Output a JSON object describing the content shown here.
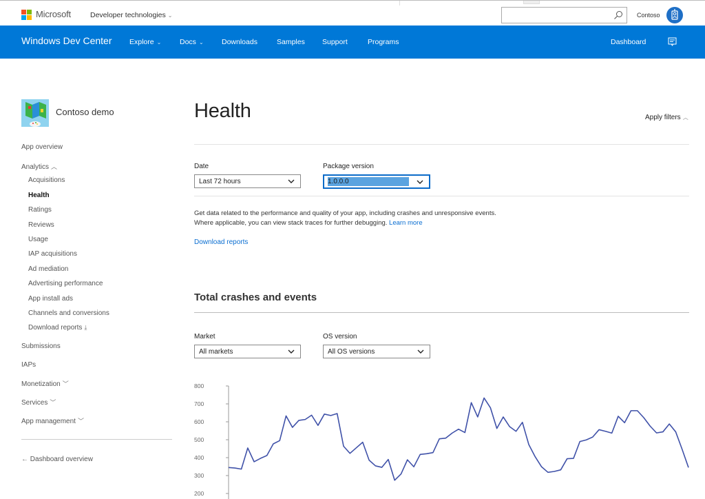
{
  "topbar": {
    "brand": "Microsoft",
    "dev_tech": "Developer technologies",
    "search": {
      "value": "",
      "placeholder": ""
    },
    "user_name": "Contoso",
    "logo_colors": [
      "#f25022",
      "#7fba00",
      "#00a4ef",
      "#ffb900"
    ]
  },
  "navbar": {
    "brand": "Windows Dev Center",
    "items": [
      {
        "label": "Explore",
        "has_dropdown": true
      },
      {
        "label": "Docs",
        "has_dropdown": true
      },
      {
        "label": "Downloads",
        "has_dropdown": false
      },
      {
        "label": "Samples",
        "has_dropdown": false
      },
      {
        "label": "Support",
        "has_dropdown": false
      },
      {
        "label": "Programs",
        "has_dropdown": false
      }
    ],
    "dashboard": "Dashboard",
    "accent": "#0078d7"
  },
  "sidebar": {
    "app_name": "Contoso demo",
    "items": [
      {
        "label": "App overview"
      },
      {
        "label": "Analytics",
        "chevron": "up"
      },
      {
        "label": "Acquisitions",
        "sub": true
      },
      {
        "label": "Health",
        "sub": true,
        "active": true
      },
      {
        "label": "Ratings",
        "sub": true
      },
      {
        "label": "Reviews",
        "sub": true
      },
      {
        "label": "Usage",
        "sub": true
      },
      {
        "label": "IAP acquisitions",
        "sub": true
      },
      {
        "label": "Ad mediation",
        "sub": true
      },
      {
        "label": "Advertising performance",
        "sub": true
      },
      {
        "label": "App install ads",
        "sub": true
      },
      {
        "label": "Channels and conversions",
        "sub": true
      },
      {
        "label": "Download reports",
        "sub": true,
        "icon": "download"
      },
      {
        "label": "Submissions"
      },
      {
        "label": "IAPs"
      },
      {
        "label": "Monetization",
        "chevron": "down"
      },
      {
        "label": "Services",
        "chevron": "down"
      },
      {
        "label": "App management",
        "chevron": "down"
      }
    ],
    "back_link": "Dashboard overview"
  },
  "main": {
    "title": "Health",
    "apply_filters": "Apply filters",
    "filters": {
      "date": {
        "label": "Date",
        "value": "Last 72 hours"
      },
      "package": {
        "label": "Package version",
        "value": "1.0.0.0"
      }
    },
    "description_line1": "Get data related to the performance and quality of your app, including crashes and unresponsive events.",
    "description_line2": "Where applicable, you can view stack traces for further debugging.",
    "learn_more": "Learn more",
    "download_reports": "Download reports",
    "section_title": "Total crashes and events",
    "section_filters": {
      "market": {
        "label": "Market",
        "value": "All markets"
      },
      "os": {
        "label": "OS version",
        "value": "All OS versions"
      }
    }
  },
  "chart_data": {
    "type": "line",
    "title": "Total crashes and events",
    "xlabel": "",
    "ylabel": "",
    "ylim": [
      200,
      800
    ],
    "yticks": [
      800,
      700,
      600,
      500,
      400,
      300,
      200
    ],
    "grid": false,
    "line_color": "#3f51a8",
    "series": [
      {
        "name": "Total crashes and events",
        "values": [
          345,
          342,
          336,
          454,
          377,
          396,
          412,
          477,
          495,
          633,
          569,
          608,
          613,
          637,
          580,
          643,
          635,
          646,
          464,
          424,
          455,
          486,
          386,
          354,
          346,
          390,
          274,
          309,
          388,
          349,
          418,
          422,
          428,
          505,
          509,
          537,
          559,
          540,
          707,
          627,
          733,
          678,
          563,
          627,
          573,
          547,
          597,
          473,
          405,
          349,
          318,
          323,
          332,
          394,
          396,
          490,
          499,
          515,
          556,
          547,
          537,
          631,
          595,
          662,
          662,
          623,
          576,
          538,
          544,
          588,
          544,
          447,
          345
        ]
      }
    ]
  }
}
